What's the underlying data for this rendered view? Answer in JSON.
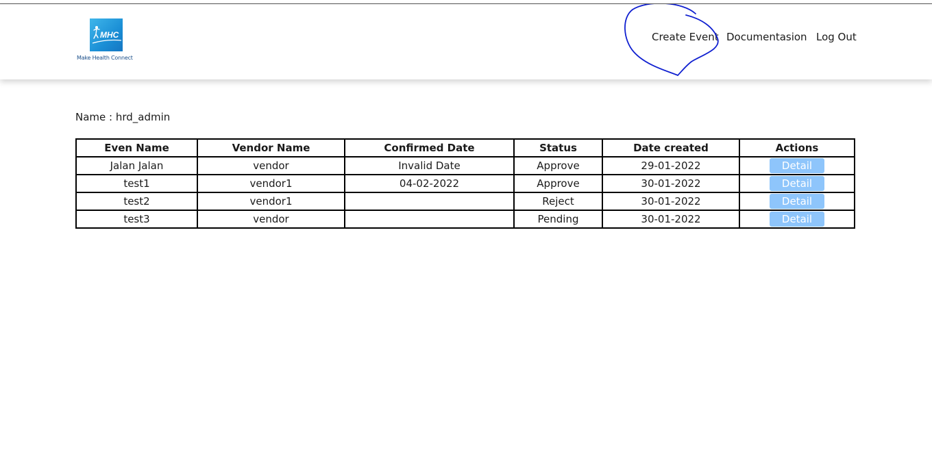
{
  "brand": {
    "logo_text": "MHC",
    "tagline": "Make Health Connect",
    "logo_color": "#1b8fd6"
  },
  "nav": {
    "create_event": "Create Event",
    "documentation": "Documentasion",
    "logout": "Log Out"
  },
  "user": {
    "name_label": "Name : hrd_admin"
  },
  "table": {
    "headers": [
      "Even Name",
      "Vendor Name",
      "Confirmed Date",
      "Status",
      "Date created",
      "Actions"
    ],
    "rows": [
      {
        "event": "Jalan Jalan",
        "vendor": "vendor",
        "confirmed": "Invalid Date",
        "status": "Approve",
        "created": "29-01-2022",
        "action": "Detail"
      },
      {
        "event": "test1",
        "vendor": "vendor1",
        "confirmed": "04-02-2022",
        "status": "Approve",
        "created": "30-01-2022",
        "action": "Detail"
      },
      {
        "event": "test2",
        "vendor": "vendor1",
        "confirmed": "",
        "status": "Reject",
        "created": "30-01-2022",
        "action": "Detail"
      },
      {
        "event": "test3",
        "vendor": "vendor",
        "confirmed": "",
        "status": "Pending",
        "created": "30-01-2022",
        "action": "Detail"
      }
    ]
  },
  "colors": {
    "detail_button": "#8ec5fb",
    "annotation_stroke": "#1020d0"
  }
}
